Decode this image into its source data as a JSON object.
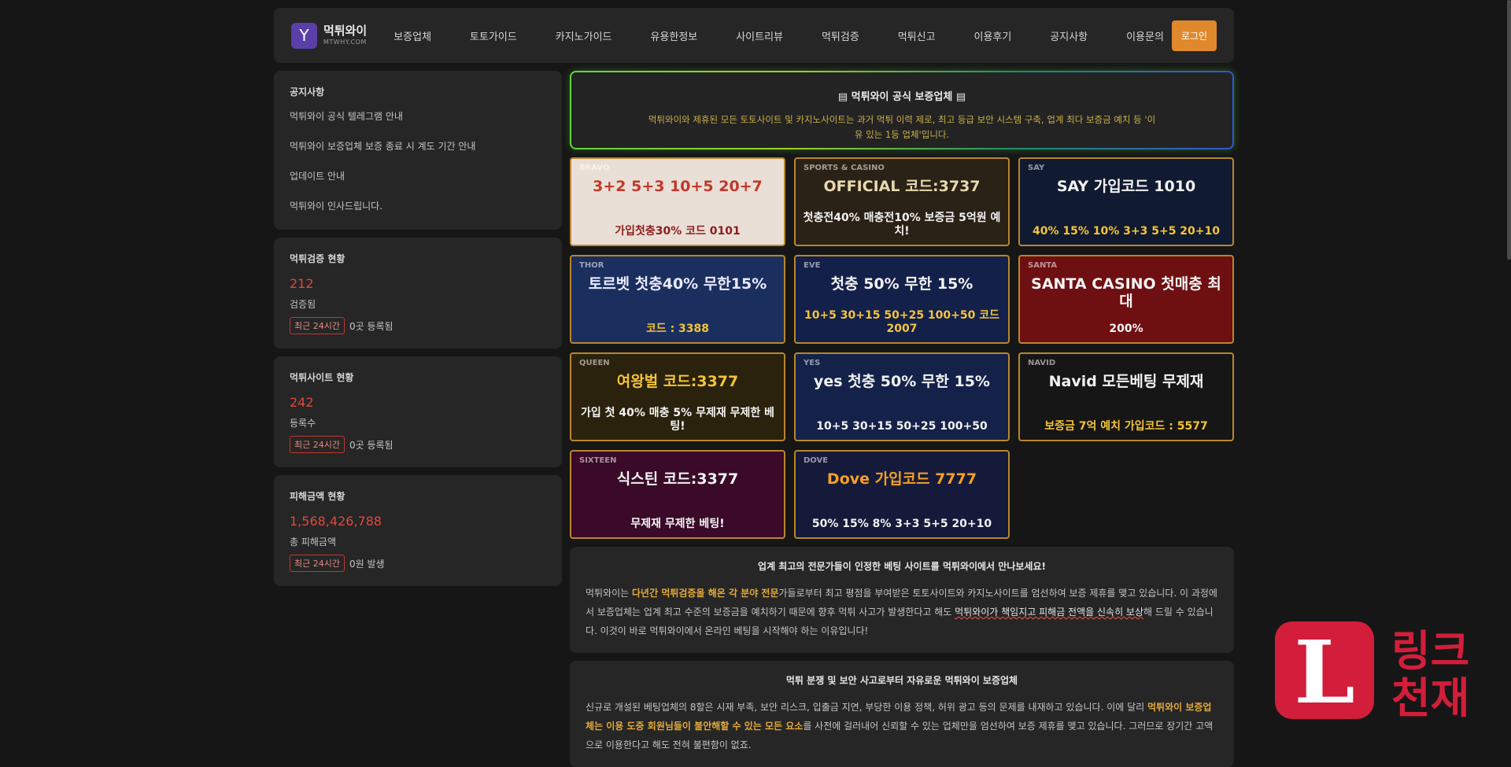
{
  "header": {
    "logo_letter": "Y",
    "logo_name": "먹튀와이",
    "logo_sub": "MTWHY.COM",
    "nav": [
      "보증업체",
      "토토가이드",
      "카지노가이드",
      "유용한정보",
      "사이트리뷰",
      "먹튀검증",
      "먹튀신고",
      "이용후기",
      "공지사항",
      "이용문의"
    ],
    "login_label": "로그인"
  },
  "sidebar": {
    "notice": {
      "title": "공지사항",
      "items": [
        "먹튀와이 공식 텔레그램 안내",
        "먹튀와이 보증업체 보증 종료 시 계도 기간 안내",
        "업데이트 안내",
        "먹튀와이 인사드립니다."
      ]
    },
    "verify": {
      "title": "먹튀검증 현황",
      "value": "212",
      "label": "검증됨",
      "badge": "최근 24시간",
      "recent": "0곳 등록됨"
    },
    "sites": {
      "title": "먹튀사이트 현황",
      "value": "242",
      "label": "등록수",
      "badge": "최근 24시간",
      "recent": "0곳 등록됨"
    },
    "damage": {
      "title": "피해금액 현황",
      "value": "1,568,426,788",
      "label": "총 피해금액",
      "badge": "최근 24시간",
      "recent": "0원 발생"
    }
  },
  "hero": {
    "title": "▤ 먹튀와이 공식 보증업체 ▤",
    "desc": "먹튀와이와 제휴된 모든 토토사이트 및 카지노사이트는 과거 먹튀 이력 제로, 최고 등급 보안 시스템 구축, 업계 최다 보증금 예치 등 '이유 있는 1등 업체'입니다."
  },
  "banners": [
    {
      "t1": "3+2 5+3 10+5 20+7",
      "t2": "가입첫충30% 코드 0101",
      "bg": "#eadfd6",
      "c1": "#c0392b",
      "c2": "#8b1e1e",
      "brand": "BRAVO"
    },
    {
      "t1": "OFFICIAL 코드:3737",
      "t2": "첫충전40% 매충전10% 보증금 5억원 예치!",
      "bg": "#2a2216",
      "c1": "#e8d9b0",
      "c2": "#f2f2f2",
      "brand": "SPORTS & CASINO"
    },
    {
      "t1": "SAY 가입코드 1010",
      "t2": "40% 15% 10% 3+3 5+5 20+10",
      "bg": "#101a30",
      "c1": "#f2f2f2",
      "c2": "#f4c438",
      "brand": "SAY"
    },
    {
      "t1": "토르벳 첫충40% 무한15%",
      "t2": "코드 : 3388",
      "bg": "#1b2f5e",
      "c1": "#e9e9ff",
      "c2": "#f4c438",
      "brand": "THOR"
    },
    {
      "t1": "첫충 50% 무한 15%",
      "t2": "10+5 30+15 50+25 100+50 코드 2007",
      "bg": "#13204a",
      "c1": "#f2f2f2",
      "c2": "#f4c438",
      "brand": "EVE"
    },
    {
      "t1": "SANTA CASINO 첫매충 최대",
      "t2": "200%",
      "bg": "#6e0f12",
      "c1": "#f4f4f4",
      "c2": "#f4f4f4",
      "brand": "SANTA"
    },
    {
      "t1": "여왕벌 코드:3377",
      "t2": "가입 첫 40% 매충 5% 무제재 무제한 베팅!",
      "bg": "#2a220c",
      "c1": "#f4c438",
      "c2": "#f4f4f4",
      "brand": "QUEEN"
    },
    {
      "t1": "yes 첫충 50% 무한 15%",
      "t2": "10+5 30+15 50+25 100+50",
      "bg": "#14224a",
      "c1": "#f2f2f2",
      "c2": "#f2f2f2",
      "brand": "YES"
    },
    {
      "t1": "Navid 모든베팅 무제재",
      "t2": "보증금 7억 예치 가입코드 : 5577",
      "bg": "#161616",
      "c1": "#f2f2f2",
      "c2": "#f4c438",
      "brand": "NAVID"
    },
    {
      "t1": "식스틴 코드:3377",
      "t2": "무제재 무제한 베팅!",
      "bg": "#3a0a28",
      "c1": "#f2f2f2",
      "c2": "#f4f4f4",
      "brand": "SIXTEEN"
    },
    {
      "t1": "Dove 가입코드 7777",
      "t2": "50% 15% 8% 3+3 5+5 20+10",
      "bg": "#151a3a",
      "c1": "#f4a024",
      "c2": "#f2f2f2",
      "brand": "DOVE"
    }
  ],
  "info1": {
    "title": "업계 최고의 전문가들이 인정한 베팅 사이트를 먹튀와이에서 만나보세요!",
    "p_a": "먹튀와이는 ",
    "p_hl": "다년간 먹튀검증을 해온 각 분야 전문",
    "p_b": "가들로부터 최고 평점을 부여받은 토토사이트와 카지노사이트를 엄선하여 보증 제휴를 맺고 있습니다. 이 과정에서 보증업체는 업계 최고 수준의 보증금을 예치하기 때문에 향후 먹튀 사고가 발생한다고 해도 ",
    "p_ul": "먹튀와이가 책임지고 피해금 전액을 신속히 보상",
    "p_c": "해 드릴 수 있습니다. 이것이 바로 먹튀와이에서 온라인 베팅을 시작해야 하는 이유입니다!"
  },
  "info2": {
    "title": "먹튀 분쟁 및 보안 사고로부터 자유로운 먹튀와이 보증업체",
    "p_a": "신규로 개설된 베팅업체의 8할은 시재 부족, 보안 리스크, 입출금 지연, 부당한 이용 정책, 허위 광고 등의 문제를 내재하고 있습니다. 이에 달리 ",
    "p_hl": "먹튀와이 보증업체는 이용 도중 회원님들이 불안해할 수 있는 모든 요소",
    "p_b": "를 사전에 걸러내어 신뢰할 수 있는 업체만을 엄선하여 보증 제휴를 맺고 있습니다. 그러므로 장기간 고액으로 이용한다고 해도 전혀 불편함이 없죠."
  },
  "watermark": {
    "letter": "L",
    "line1": "링크",
    "line2": "천재"
  }
}
